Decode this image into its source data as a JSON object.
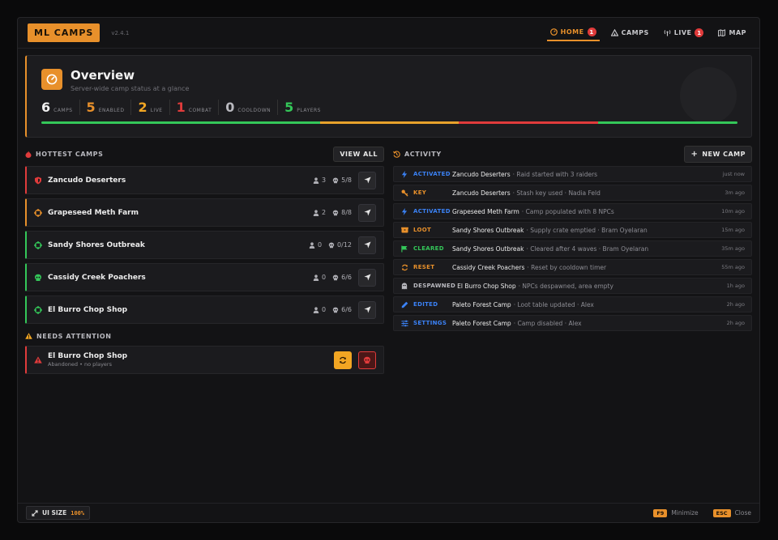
{
  "app": {
    "title": "ML CAMPS",
    "version": "v2.4.1"
  },
  "nav": [
    {
      "label": "HOME",
      "badge": "1",
      "active": true,
      "icon": "gauge-icon"
    },
    {
      "label": "CAMPS",
      "badge": "",
      "active": false,
      "icon": "tent-icon"
    },
    {
      "label": "LIVE",
      "badge": "1",
      "active": false,
      "icon": "broadcast-icon"
    },
    {
      "label": "MAP",
      "badge": "",
      "active": false,
      "icon": "map-icon"
    }
  ],
  "overview": {
    "title": "Overview",
    "subtitle": "Server-wide camp status at a glance",
    "stats": [
      {
        "value": "6",
        "label": "CAMPS",
        "color": "#f0f0f0"
      },
      {
        "value": "5",
        "label": "ENABLED",
        "color": "#e8902b"
      },
      {
        "value": "2",
        "label": "LIVE",
        "color": "#f2a623"
      },
      {
        "value": "1",
        "label": "COMBAT",
        "color": "#e03b3b"
      },
      {
        "value": "0",
        "label": "COOLDOWN",
        "color": "#b9b9bf"
      },
      {
        "value": "5",
        "label": "PLAYERS",
        "color": "#34c759"
      }
    ],
    "progress": [
      {
        "color": "#34c759",
        "fraction": 0.4
      },
      {
        "color": "#e8a22b",
        "fraction": 0.2
      },
      {
        "color": "#e03b3b",
        "fraction": 0.2
      },
      {
        "color": "#34c759",
        "fraction": 0.2
      }
    ]
  },
  "hottest": {
    "title": "HOTTEST CAMPS",
    "view_all": "VIEW ALL",
    "camps": [
      {
        "name": "Zancudo Deserters",
        "players": "3",
        "npcs": "5/8",
        "accent": "#e03b3b",
        "icon": "shield-icon"
      },
      {
        "name": "Grapeseed Meth Farm",
        "players": "2",
        "npcs": "8/8",
        "accent": "#e8902b",
        "icon": "crosshair-icon"
      },
      {
        "name": "Sandy Shores Outbreak",
        "players": "0",
        "npcs": "0/12",
        "accent": "#34c759",
        "icon": "crosshair-icon"
      },
      {
        "name": "Cassidy Creek Poachers",
        "players": "0",
        "npcs": "6/6",
        "accent": "#34c759",
        "icon": "skull-icon"
      },
      {
        "name": "El Burro Chop Shop",
        "players": "0",
        "npcs": "6/6",
        "accent": "#34c759",
        "icon": "crosshair-icon"
      }
    ]
  },
  "attention": {
    "title": "NEEDS ATTENTION",
    "items": [
      {
        "name": "El Burro Chop Shop",
        "sub": "Abandoned • no players"
      }
    ]
  },
  "activity": {
    "title": "ACTIVITY",
    "new_camp": "NEW CAMP",
    "items": [
      {
        "type": "ACTIVATED",
        "color": "#3b82f6",
        "icon": "bolt-icon",
        "camp": "Zancudo Deserters",
        "desc": "· Raid started with 3 raiders",
        "time": "just now"
      },
      {
        "type": "KEY",
        "color": "#e8902b",
        "icon": "key-icon",
        "camp": "Zancudo Deserters",
        "desc": "· Stash key used · Nadia Feld",
        "time": "3m ago"
      },
      {
        "type": "ACTIVATED",
        "color": "#3b82f6",
        "icon": "bolt-icon",
        "camp": "Grapeseed Meth Farm",
        "desc": "· Camp populated with 8 NPCs",
        "time": "10m ago"
      },
      {
        "type": "LOOT",
        "color": "#e8902b",
        "icon": "crate-icon",
        "camp": "Sandy Shores Outbreak",
        "desc": "· Supply crate emptied · Bram Oyelaran",
        "time": "15m ago"
      },
      {
        "type": "CLEARED",
        "color": "#34c759",
        "icon": "flag-icon",
        "camp": "Sandy Shores Outbreak",
        "desc": "· Cleared after 4 waves · Bram Oyelaran",
        "time": "35m ago"
      },
      {
        "type": "RESET",
        "color": "#e8902b",
        "icon": "refresh-icon",
        "camp": "Cassidy Creek Poachers",
        "desc": "· Reset by cooldown timer",
        "time": "55m ago"
      },
      {
        "type": "DESPAWNED",
        "color": "#b9b9bf",
        "icon": "ghost-icon",
        "camp": "El Burro Chop Shop",
        "desc": "· NPCs despawned, area empty",
        "time": "1h ago"
      },
      {
        "type": "EDITED",
        "color": "#3b82f6",
        "icon": "pencil-icon",
        "camp": "Paleto Forest Camp",
        "desc": "· Loot table updated · Alex",
        "time": "2h ago"
      },
      {
        "type": "SETTINGS",
        "color": "#3b82f6",
        "icon": "sliders-icon",
        "camp": "Paleto Forest Camp",
        "desc": "· Camp disabled · Alex",
        "time": "2h ago"
      }
    ]
  },
  "footer": {
    "ui_size_label": "UI SIZE",
    "ui_size_value": "100%",
    "hotkeys": [
      {
        "key": "F9",
        "label": "Minimize"
      },
      {
        "key": "ESC",
        "label": "Close"
      }
    ]
  }
}
